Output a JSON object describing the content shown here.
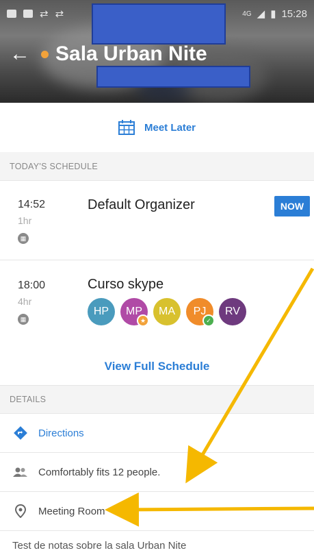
{
  "status_bar": {
    "signal": "4G",
    "time": "15:28"
  },
  "header": {
    "title": "Sala Urban Nite",
    "status_color": "#f2a23a"
  },
  "meet_later": {
    "label": "Meet Later",
    "accent": "#2b7ed6"
  },
  "schedule": {
    "heading": "TODAY'S SCHEDULE",
    "events": [
      {
        "time": "14:52",
        "duration": "1hr",
        "title": "Default Organizer",
        "badge": "NOW"
      },
      {
        "time": "18:00",
        "duration": "4hr",
        "title": "Curso skype",
        "attendees": [
          {
            "initials": "HP",
            "color": "#4a9bbd"
          },
          {
            "initials": "MP",
            "color": "#b04aa6",
            "badge": "star"
          },
          {
            "initials": "MA",
            "color": "#d8c12e"
          },
          {
            "initials": "PJ",
            "color": "#f08c2a",
            "badge": "check"
          },
          {
            "initials": "RV",
            "color": "#6e3a7e"
          }
        ]
      }
    ],
    "view_full": "View Full Schedule"
  },
  "details": {
    "heading": "DETAILS",
    "directions": "Directions",
    "capacity": "Comfortably fits 12 people.",
    "room_type": "Meeting Room",
    "notes": "Test de notas sobre la sala Urban Nite"
  },
  "annotation_color": "#f5b800"
}
